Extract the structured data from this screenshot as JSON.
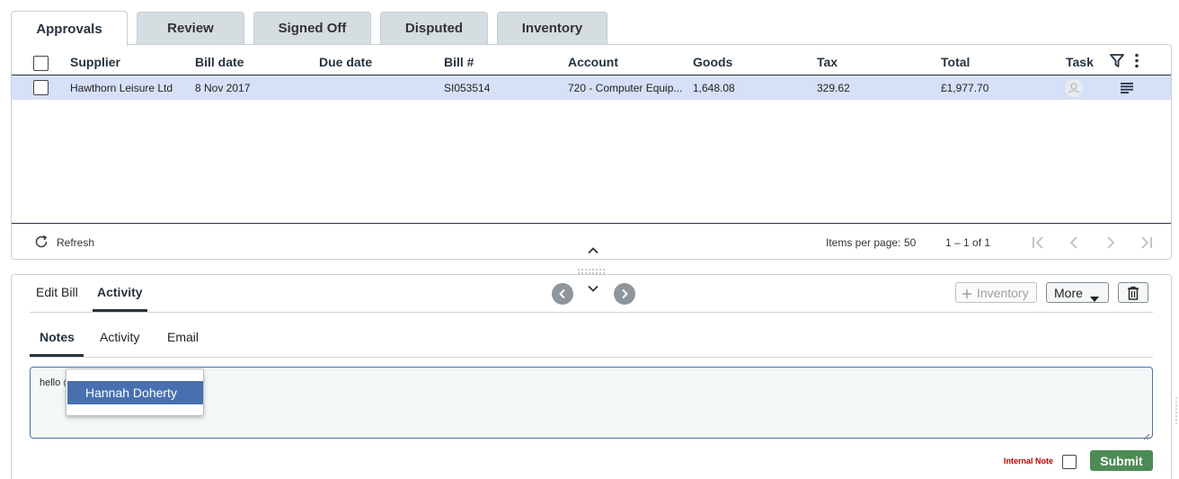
{
  "tabs": [
    "Approvals",
    "Review",
    "Signed Off",
    "Disputed",
    "Inventory"
  ],
  "grid": {
    "columns": [
      "Supplier",
      "Bill date",
      "Due date",
      "Bill #",
      "Account",
      "Goods",
      "Tax",
      "Total",
      "Task"
    ],
    "rows": [
      {
        "supplier": "Hawthorn Leisure Ltd",
        "bill_date": "8 Nov 2017",
        "due_date": "",
        "bill_no": "SI053514",
        "account": "720 - Computer Equip...",
        "goods": "1,648.08",
        "tax": "329.62",
        "total": "£1,977.70"
      }
    ],
    "footer": {
      "refresh_label": "Refresh",
      "items_per_page_label": "Items per page:",
      "items_per_page_value": "50",
      "range_label": "1 – 1 of 1"
    }
  },
  "detail": {
    "tabs": [
      "Edit Bill",
      "Activity"
    ],
    "inventory_button": "Inventory",
    "more_button": "More",
    "subtabs": [
      "Notes",
      "Activity",
      "Email"
    ],
    "note_text": "hello @",
    "mention_options": [
      "Hannah Doherty"
    ],
    "internal_note_label": "Internal Note",
    "submit_label": "Submit"
  },
  "colors": {
    "header_text": "#263340",
    "selected_row": "#d6e0f7",
    "mention_highlight": "#4870b0",
    "submit": "#4d8b55",
    "internal_note": "#c00000"
  }
}
